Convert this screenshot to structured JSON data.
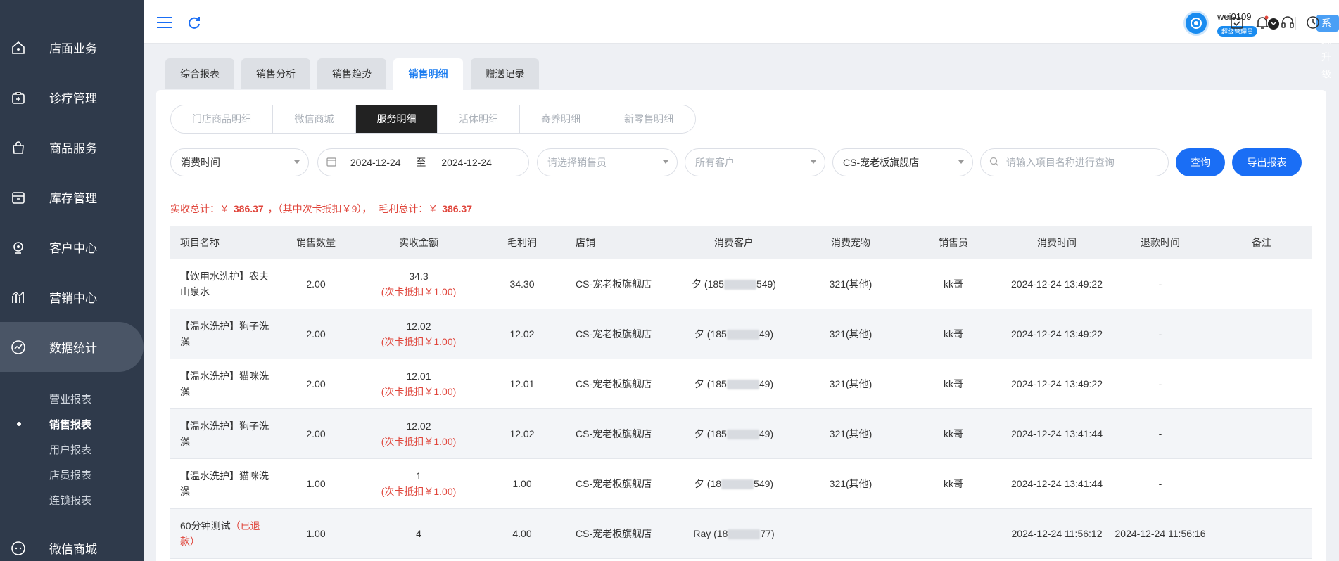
{
  "sidebar": {
    "items": [
      {
        "label": "店面业务",
        "icon": "shop-icon"
      },
      {
        "label": "诊疗管理",
        "icon": "medical-kit-icon"
      },
      {
        "label": "商品服务",
        "icon": "bag-icon"
      },
      {
        "label": "库存管理",
        "icon": "box-icon"
      },
      {
        "label": "客户中心",
        "icon": "headset-icon"
      },
      {
        "label": "营销中心",
        "icon": "chart-icon"
      },
      {
        "label": "数据统计",
        "icon": "trend-icon"
      },
      {
        "label": "微信商城",
        "icon": "wechat-icon"
      }
    ],
    "active_index": 6,
    "sub_items": [
      "营业报表",
      "销售报表",
      "用户报表",
      "店员报表",
      "连锁报表"
    ],
    "active_sub_index": 1
  },
  "header": {
    "username": "wei0109",
    "role": "超级管理员",
    "upgrade_label": "系统升级"
  },
  "main_tabs": [
    "综合报表",
    "销售分析",
    "销售趋势",
    "销售明细",
    "赠送记录"
  ],
  "active_main_tab": 3,
  "sub_tabs": [
    "门店商品明细",
    "微信商城",
    "服务明细",
    "活体明细",
    "寄养明细",
    "新零售明细"
  ],
  "active_sub_tab": 2,
  "filters": {
    "time_type": "消费时间",
    "date_from": "2024-12-24",
    "date_sep": "至",
    "date_to": "2024-12-24",
    "salesperson_placeholder": "请选择销售员",
    "customer": "所有客户",
    "store": "CS-宠老板旗舰店",
    "search_placeholder": "请输入项目名称进行查询",
    "query_label": "查询",
    "export_label": "导出报表"
  },
  "summary": {
    "paid_label": "实收总计：￥",
    "paid_value": "386.37",
    "card_note": "，（其中次卡抵扣￥9），",
    "profit_label": "毛利总计：￥",
    "profit_value": "386.37"
  },
  "table": {
    "headers": [
      "项目名称",
      "销售数量",
      "实收金额",
      "毛利润",
      "店铺",
      "消费客户",
      "消费宠物",
      "销售员",
      "消费时间",
      "退款时间",
      "备注"
    ],
    "rows": [
      {
        "name": "【饮用水洗护】农夫山泉水",
        "name_note": "",
        "qty": "2.00",
        "amount": "34.3",
        "deduct": "(次卡抵扣￥1.00)",
        "profit": "34.30",
        "store": "CS-宠老板旗舰店",
        "customer_pre": "夕 (185",
        "customer_post": "549)",
        "pet": "321(其他)",
        "seller": "kk哥",
        "time": "2024-12-24 13:49:22",
        "refund": "-",
        "remark": ""
      },
      {
        "name": "【温水洗护】狗子洗澡",
        "name_note": "",
        "qty": "2.00",
        "amount": "12.02",
        "deduct": "(次卡抵扣￥1.00)",
        "profit": "12.02",
        "store": "CS-宠老板旗舰店",
        "customer_pre": "夕 (185",
        "customer_post": "49)",
        "pet": "321(其他)",
        "seller": "kk哥",
        "time": "2024-12-24 13:49:22",
        "refund": "-",
        "remark": ""
      },
      {
        "name": "【温水洗护】猫咪洗澡",
        "name_note": "",
        "qty": "2.00",
        "amount": "12.01",
        "deduct": "(次卡抵扣￥1.00)",
        "profit": "12.01",
        "store": "CS-宠老板旗舰店",
        "customer_pre": "夕 (185",
        "customer_post": "49)",
        "pet": "321(其他)",
        "seller": "kk哥",
        "time": "2024-12-24 13:49:22",
        "refund": "-",
        "remark": ""
      },
      {
        "name": "【温水洗护】狗子洗澡",
        "name_note": "",
        "qty": "2.00",
        "amount": "12.02",
        "deduct": "(次卡抵扣￥1.00)",
        "profit": "12.02",
        "store": "CS-宠老板旗舰店",
        "customer_pre": "夕 (185",
        "customer_post": "49)",
        "pet": "321(其他)",
        "seller": "kk哥",
        "time": "2024-12-24 13:41:44",
        "refund": "-",
        "remark": ""
      },
      {
        "name": "【温水洗护】猫咪洗澡",
        "name_note": "",
        "qty": "1.00",
        "amount": "1",
        "deduct": "(次卡抵扣￥1.00)",
        "profit": "1.00",
        "store": "CS-宠老板旗舰店",
        "customer_pre": "夕 (18",
        "customer_post": "549)",
        "pet": "321(其他)",
        "seller": "kk哥",
        "time": "2024-12-24 13:41:44",
        "refund": "-",
        "remark": ""
      },
      {
        "name": "60分钟测试",
        "name_note": "（已退款）",
        "qty": "1.00",
        "amount": "4",
        "deduct": "",
        "profit": "4.00",
        "store": "CS-宠老板旗舰店",
        "customer_pre": "Ray (18",
        "customer_post": "77)",
        "pet": "",
        "seller": "",
        "time": "2024-12-24 11:56:12",
        "refund": "2024-12-24 11:56:16",
        "remark": ""
      }
    ]
  }
}
